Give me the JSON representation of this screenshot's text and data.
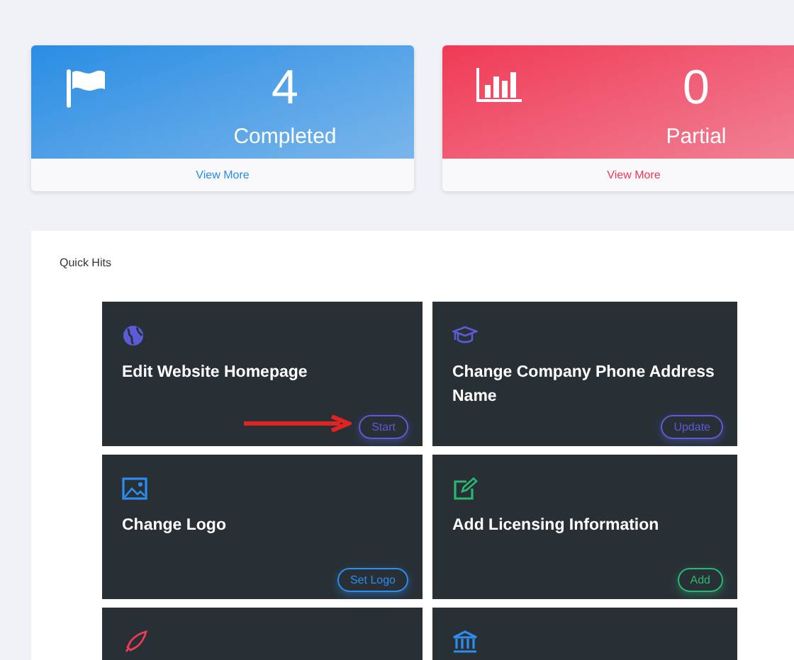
{
  "stats": [
    {
      "kind": "flag",
      "value": "4",
      "label": "Completed",
      "link": "View More",
      "color": "#2a8de3"
    },
    {
      "kind": "chart",
      "value": "0",
      "label": "Partial",
      "link": "View More",
      "color": "#f03a56"
    }
  ],
  "quick_hits": {
    "title": "Quick Hits",
    "tiles": [
      {
        "kind": "globe",
        "color": "#5b5bd6",
        "title": "Edit Website Homepage",
        "button": "Start",
        "arrow": true
      },
      {
        "kind": "cap",
        "color": "#5b5bd6",
        "title": "Change Company Phone Address Name",
        "button": "Update",
        "arrow": false
      },
      {
        "kind": "image",
        "color": "#2d8cf0",
        "title": "Change Logo",
        "button": "Set Logo",
        "arrow": false
      },
      {
        "kind": "edit",
        "color": "#2bb673",
        "title": "Add Licensing Information",
        "button": "Add",
        "arrow": false
      },
      {
        "kind": "rocket",
        "color": "#f03a5a",
        "arrow": false
      },
      {
        "kind": "bank",
        "color": "#2d8cf0",
        "arrow": false
      }
    ]
  }
}
